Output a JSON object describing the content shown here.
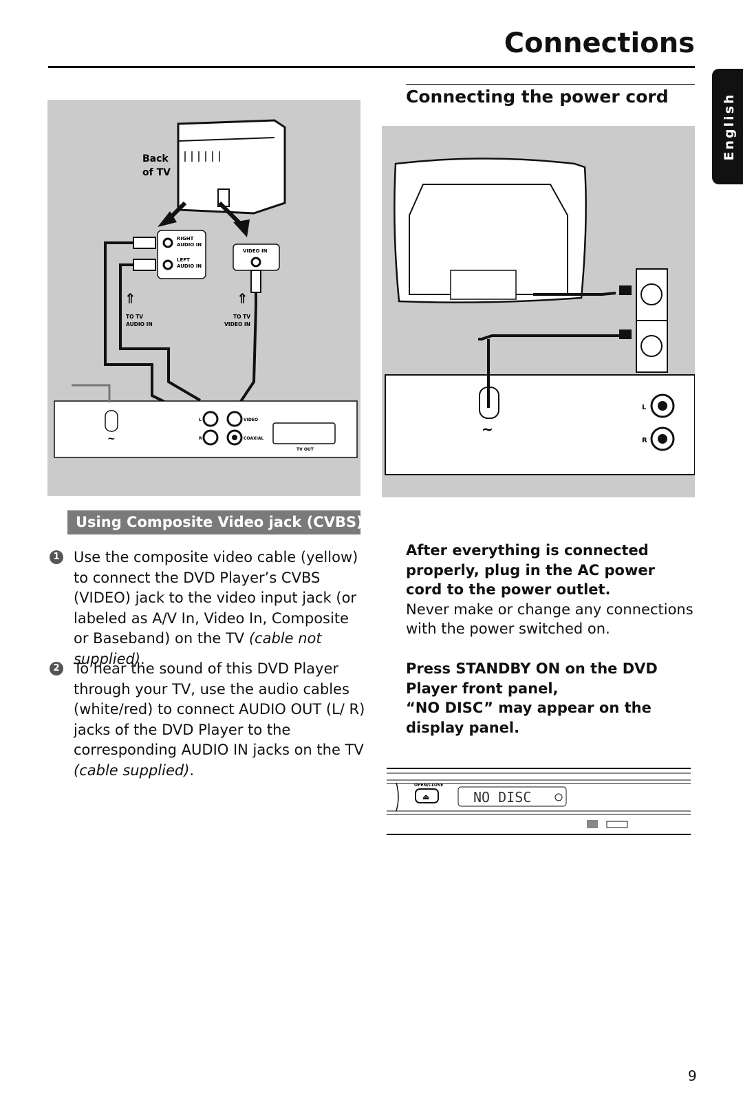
{
  "header": {
    "title": "Connections",
    "language_tab": "English"
  },
  "left_figure": {
    "back_of_tv": [
      "Back",
      "of TV"
    ],
    "right_audio_in": [
      "RIGHT",
      "AUDIO IN"
    ],
    "left_audio_in": [
      "LEFT",
      "AUDIO IN"
    ],
    "video_in": "VIDEO IN",
    "to_tv_audio_in": [
      "TO TV",
      "AUDIO IN"
    ],
    "to_tv_video_in": [
      "TO TV",
      "VIDEO IN"
    ],
    "jack_l": "L",
    "jack_r": "R",
    "jack_video": "VIDEO",
    "jack_coaxial": "COAXIAL",
    "tv_out": "TV OUT"
  },
  "left_section": {
    "banner": "Using Composite Video jack (CVBS)",
    "steps": [
      {
        "num": "1",
        "text": "Use the composite video cable (yellow) to connect the DVD Player’s CVBS (VIDEO) jack to the video input jack (or labeled as A/V In, Video In, Composite or Baseband) on the TV ",
        "italic": "(cable not supplied)",
        "end": "."
      },
      {
        "num": "2",
        "text": "To hear the sound of this DVD Player through your TV, use the audio cables (white/red) to connect AUDIO OUT (L/ R) jacks of the DVD Player to the corresponding AUDIO IN jacks on the TV ",
        "italic": "(cable supplied)",
        "end": "."
      }
    ]
  },
  "right_section": {
    "heading": "Connecting the power cord",
    "figure": {
      "jack_l": "L",
      "jack_r": "R"
    },
    "para1_bold": "After everything is connected properly, plug in the AC power cord to the power outlet.",
    "para1_normal": "Never make or change any connections with the power switched on.",
    "para2_bold_1": "Press STANDBY ON on the DVD Player front panel,",
    "para2_bold_2": "“NO DISC” may appear on the display panel.",
    "panel": {
      "open_close": "OPEN/CLOSE",
      "display": "NO DISC"
    }
  },
  "footer": {
    "page_number": "9"
  }
}
